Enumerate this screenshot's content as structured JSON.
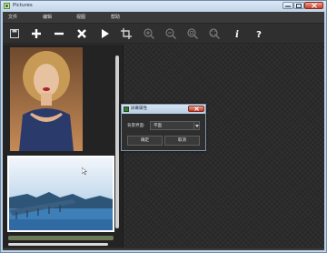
{
  "window": {
    "title": "Pictures"
  },
  "menu": {
    "items": [
      "文件",
      "编辑",
      "视图",
      "帮助"
    ]
  },
  "toolbar": {
    "icons": [
      "save-icon",
      "add-icon",
      "remove-icon",
      "delete-icon",
      "play-icon",
      "crop-icon",
      "zoom-in-icon",
      "zoom-out-icon",
      "zoom-reset-icon",
      "zoom-fit-icon",
      "info-icon",
      "help-icon"
    ],
    "info_glyph": "i",
    "help_glyph": "?"
  },
  "dialog": {
    "title": "屏幕属性",
    "field_label": "背景界面:",
    "select_value": "平面",
    "ok_label": "确定",
    "cancel_label": "取消"
  },
  "colors": {
    "accent": "#7d95b0",
    "close_red": "#c4402a",
    "canvas_bg": "#2b2b2b"
  }
}
